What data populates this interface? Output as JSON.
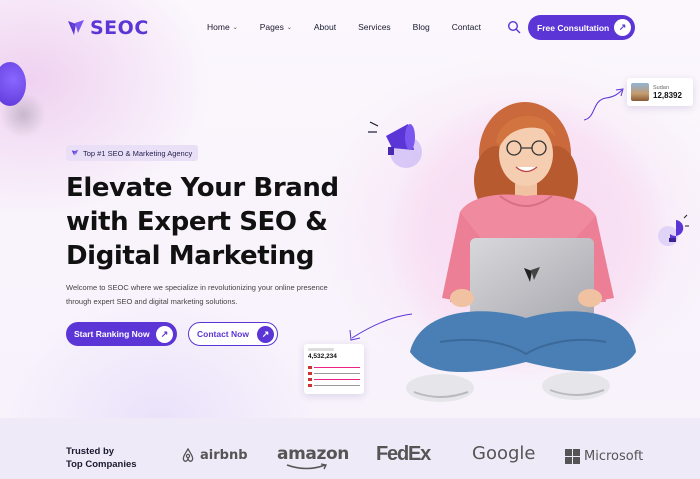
{
  "brand": {
    "name": "SEOC",
    "color": "#5b35d5"
  },
  "nav": {
    "items": [
      {
        "label": "Home",
        "has_dropdown": true
      },
      {
        "label": "Pages",
        "has_dropdown": true
      },
      {
        "label": "About",
        "has_dropdown": false
      },
      {
        "label": "Services",
        "has_dropdown": false
      },
      {
        "label": "Blog",
        "has_dropdown": false
      },
      {
        "label": "Contact",
        "has_dropdown": false
      }
    ],
    "cta_label": "Free Consultation"
  },
  "hero": {
    "badge": "Top #1 SEO & Marketing Agency",
    "headline": [
      "Elevate Your Brand",
      "with Expert SEO &",
      "Digital Marketing"
    ],
    "description": "Welcome to SEOC where we specialize in revolutionizing your online presence through expert SEO and digital marketing solutions.",
    "primary_button": "Start Ranking Now",
    "secondary_button": "Contact Now"
  },
  "stat_card": {
    "label": "Sudan",
    "value": "12,8392"
  },
  "mini_card": {
    "value": "4,532,234"
  },
  "trusted": {
    "label": [
      "Trusted by",
      "Top Companies"
    ],
    "brands": [
      "airbnb",
      "amazon",
      "FedEx",
      "Google",
      "Microsoft"
    ]
  },
  "colors": {
    "accent": "#5b35d5",
    "strip": "#efeaf8",
    "hoodie": "#f08a9e",
    "jeans": "#4a7fb5"
  },
  "icons": [
    "logo-icon",
    "chevron-down-icon",
    "search-icon",
    "arrow-up-right-icon",
    "megaphone-icon",
    "lightbulb-icon",
    "airbnb-icon",
    "microsoft-icon"
  ]
}
